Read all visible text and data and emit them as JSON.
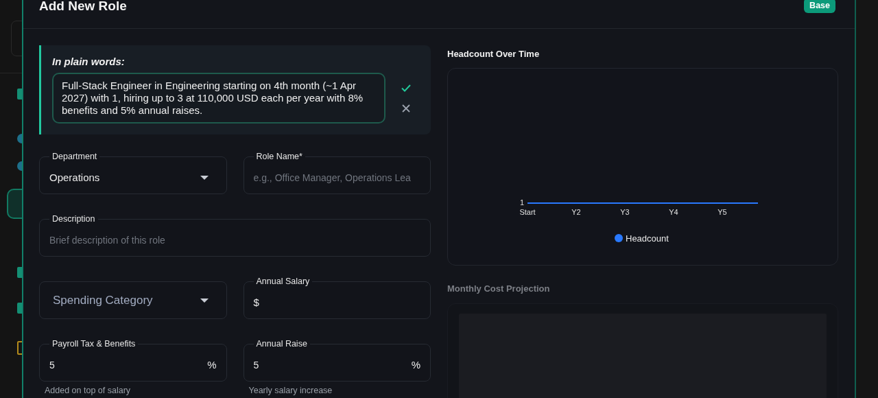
{
  "dialog": {
    "title": "Add New Role",
    "badge": "Base"
  },
  "summary": {
    "heading": "In plain words:",
    "text": "Full-Stack Engineer in Engineering starting on 4th month (~1 Apr 2027) with 1, hiring up to 3 at 110,000 USD each per year with 8% benefits and 5% annual raises."
  },
  "field_rows": [
    [
      {
        "kind": "select",
        "label": "Department",
        "value": "Operations"
      },
      {
        "kind": "text",
        "label": "Role Name*",
        "placeholder": "e.g., Office Manager, Operations Lea"
      }
    ],
    [
      {
        "kind": "text",
        "label": "Description",
        "placeholder": "Brief description of this role"
      }
    ],
    [
      {
        "kind": "select",
        "placeholder": "Spending Category"
      },
      {
        "kind": "text",
        "label": "Annual Salary",
        "prefix": "$"
      }
    ],
    [
      {
        "kind": "text",
        "label": "Payroll Tax & Benefits",
        "value": "5",
        "suffix": "%",
        "helper": "Added on top of salary"
      },
      {
        "kind": "text",
        "label": "Annual Raise",
        "value": "5",
        "suffix": "%",
        "helper": "Yearly salary increase"
      }
    ]
  ],
  "headcount_chart": {
    "title": "Headcount Over Time",
    "axis_value": "1",
    "axis_labels": [
      "Start",
      "Y2",
      "Y3",
      "Y4",
      "Y5"
    ],
    "legend": [
      {
        "name": "Headcount",
        "color": "#2979ff"
      }
    ]
  },
  "cost_chart": {
    "title": "Monthly Cost Projection",
    "loading": true
  }
}
